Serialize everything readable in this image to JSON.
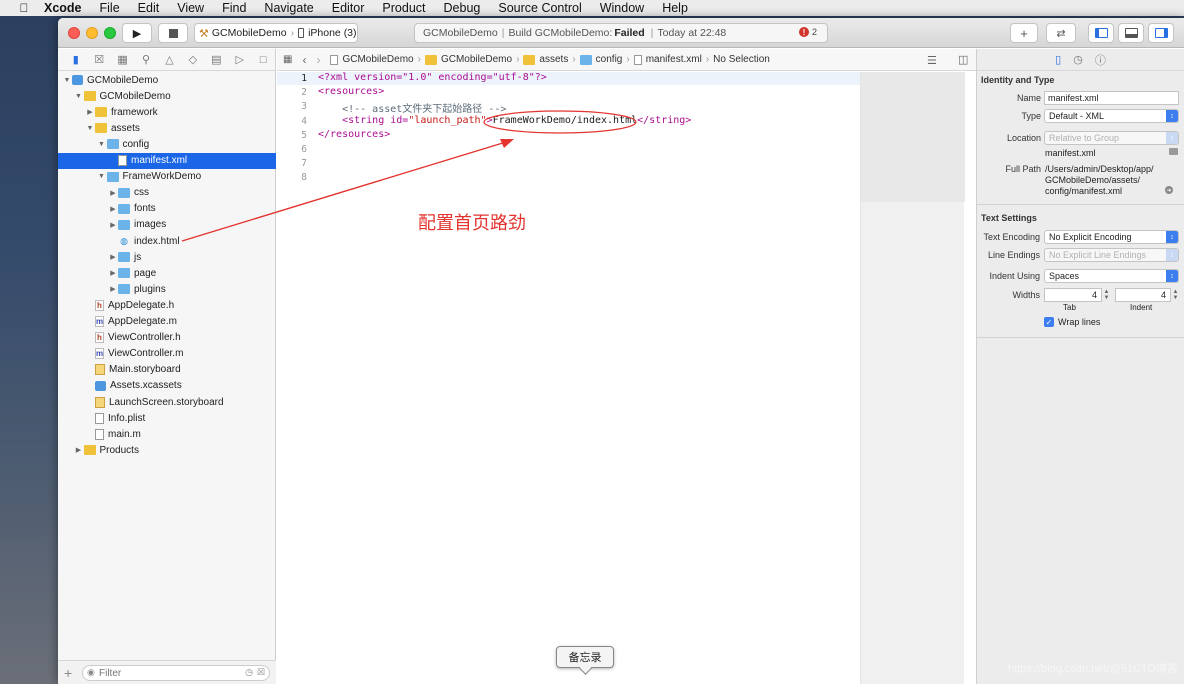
{
  "menubar": {
    "app_name": "Xcode",
    "items": [
      "File",
      "Edit",
      "View",
      "Find",
      "Navigate",
      "Editor",
      "Product",
      "Debug",
      "Source Control",
      "Window",
      "Help"
    ]
  },
  "toolbar": {
    "scheme_target": "GCMobileDemo",
    "scheme_device": "iPhone (3)",
    "activity_project": "GCMobileDemo",
    "activity_build_prefix": "Build GCMobileDemo:",
    "activity_status": "Failed",
    "activity_time": "Today at 22:48",
    "error_count": "2"
  },
  "navigator": {
    "tree": [
      {
        "label": "GCMobileDemo",
        "indent": 0,
        "disc": "open",
        "icon": "project-icon"
      },
      {
        "label": "GCMobileDemo",
        "indent": 1,
        "disc": "open",
        "icon": "folder-yellow"
      },
      {
        "label": "framework",
        "indent": 2,
        "disc": "closed",
        "icon": "folder-yellow"
      },
      {
        "label": "assets",
        "indent": 2,
        "disc": "open",
        "icon": "folder-yellow"
      },
      {
        "label": "config",
        "indent": 3,
        "disc": "open",
        "icon": "folder-blue"
      },
      {
        "label": "manifest.xml",
        "indent": 4,
        "disc": "none",
        "icon": "doc",
        "selected": true
      },
      {
        "label": "FrameWorkDemo",
        "indent": 3,
        "disc": "open",
        "icon": "folder-blue"
      },
      {
        "label": "css",
        "indent": 4,
        "disc": "closed",
        "icon": "folder-blue"
      },
      {
        "label": "fonts",
        "indent": 4,
        "disc": "closed",
        "icon": "folder-blue"
      },
      {
        "label": "images",
        "indent": 4,
        "disc": "closed",
        "icon": "folder-blue"
      },
      {
        "label": "index.html",
        "indent": 4,
        "disc": "none",
        "icon": "html"
      },
      {
        "label": "js",
        "indent": 4,
        "disc": "closed",
        "icon": "folder-blue"
      },
      {
        "label": "page",
        "indent": 4,
        "disc": "closed",
        "icon": "folder-blue"
      },
      {
        "label": "plugins",
        "indent": 4,
        "disc": "closed",
        "icon": "folder-blue"
      },
      {
        "label": "AppDelegate.h",
        "indent": 2,
        "disc": "none",
        "icon": "h"
      },
      {
        "label": "AppDelegate.m",
        "indent": 2,
        "disc": "none",
        "icon": "m"
      },
      {
        "label": "ViewController.h",
        "indent": 2,
        "disc": "none",
        "icon": "h"
      },
      {
        "label": "ViewController.m",
        "indent": 2,
        "disc": "none",
        "icon": "m"
      },
      {
        "label": "Main.storyboard",
        "indent": 2,
        "disc": "none",
        "icon": "storyboard"
      },
      {
        "label": "Assets.xcassets",
        "indent": 2,
        "disc": "none",
        "icon": "xcassets"
      },
      {
        "label": "LaunchScreen.storyboard",
        "indent": 2,
        "disc": "none",
        "icon": "storyboard"
      },
      {
        "label": "Info.plist",
        "indent": 2,
        "disc": "none",
        "icon": "doc"
      },
      {
        "label": "main.m",
        "indent": 2,
        "disc": "none",
        "icon": "doc"
      },
      {
        "label": "Products",
        "indent": 1,
        "disc": "closed",
        "icon": "folder-yellow"
      }
    ],
    "filter_placeholder": "Filter"
  },
  "jumpbar": {
    "crumbs": [
      "GCMobileDemo",
      "GCMobileDemo",
      "assets",
      "config",
      "manifest.xml",
      "No Selection"
    ]
  },
  "editor": {
    "line_numbers": [
      "1",
      "2",
      "3",
      "4",
      "5",
      "6",
      "7",
      "8"
    ],
    "current_line": "1",
    "lines": [
      [
        {
          "t": "<?xml version=\"1.0\" encoding=\"utf-8\"?>",
          "c": "kw"
        }
      ],
      [
        {
          "t": "<resources>",
          "c": "kw"
        }
      ],
      [
        {
          "t": "    <!-- asset文件夹下起始路径 -->",
          "c": "cmt"
        }
      ],
      [
        {
          "t": "    <string ",
          "c": "kw"
        },
        {
          "t": "id=",
          "c": "kw"
        },
        {
          "t": "\"launch_path\"",
          "c": "str"
        },
        {
          "t": ">",
          "c": "kw"
        },
        {
          "t": "FrameWorkDemo/index.html",
          "c": "txt"
        },
        {
          "t": "</string>",
          "c": "kw"
        }
      ],
      [
        {
          "t": "</resources>",
          "c": "kw"
        }
      ],
      [],
      [],
      []
    ]
  },
  "inspector": {
    "identity_title": "Identity and Type",
    "name_label": "Name",
    "name_value": "manifest.xml",
    "type_label": "Type",
    "type_value": "Default - XML",
    "location_label": "Location",
    "location_value": "Relative to Group",
    "location_file": "manifest.xml",
    "fullpath_label": "Full Path",
    "fullpath_lines": [
      "/Users/admin/Desktop/app/",
      "GCMobileDemo/assets/",
      "config/manifest.xml"
    ],
    "text_settings_title": "Text Settings",
    "encoding_label": "Text Encoding",
    "encoding_value": "No Explicit Encoding",
    "line_endings_label": "Line Endings",
    "line_endings_value": "No Explicit Line Endings",
    "indent_using_label": "Indent Using",
    "indent_using_value": "Spaces",
    "widths_label": "Widths",
    "tab_value": "4",
    "indent_value": "4",
    "tab_caption": "Tab",
    "indent_caption": "Indent",
    "wrap_lines_label": "Wrap lines"
  },
  "annotation": {
    "text": "配置首页路劲",
    "color": "#e3342f"
  },
  "tooltip": {
    "text": "备忘录"
  },
  "watermark": "https://blog.csdn.net/@51CTO博客",
  "colors": {
    "selection": "#1a66e6",
    "keyword": "#aa0d91",
    "string": "#c41a16",
    "accent": "#3c7ef0"
  }
}
